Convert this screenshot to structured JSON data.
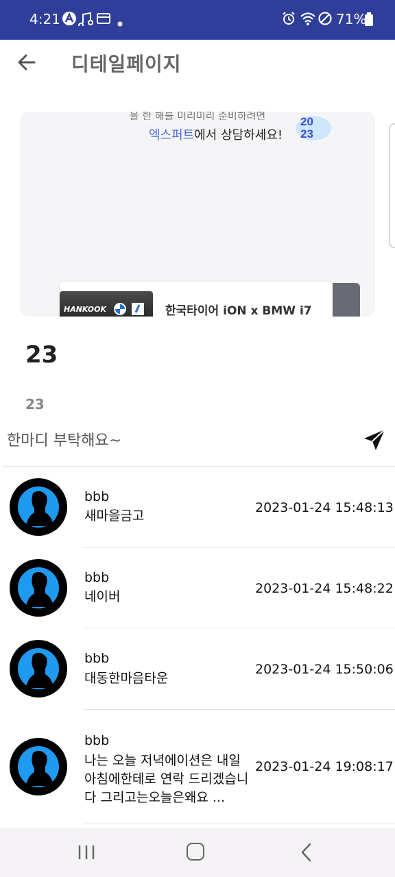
{
  "status_bar": {
    "time": "4:21",
    "battery": "71%"
  },
  "app_bar": {
    "title": "디테일페이지"
  },
  "banner": {
    "top_text": "올 한 해를 미리미리 준비하려면",
    "tagline_highlight": "엑스퍼트",
    "tagline_rest": "에서 상담하세요!",
    "badge": "2023",
    "badge_top": "20",
    "badge_bottom": "23",
    "ad_brand": "HANKOOK",
    "ad_title": "한국타이어 iON x BMW i7"
  },
  "post": {
    "title": "23",
    "body": "23"
  },
  "comment_input": {
    "placeholder": "한마디 부탁해요~"
  },
  "comments": [
    {
      "user": "bbb",
      "text": "새마을금고",
      "time": "2023-01-24 15:48:13"
    },
    {
      "user": "bbb",
      "text": "네이버",
      "time": "2023-01-24 15:48:22"
    },
    {
      "user": "bbb",
      "text": "대동한마음타운",
      "time": "2023-01-24 15:50:06"
    },
    {
      "user": "bbb",
      "text": "나는 오늘 저녁에이션은 내일 아침에한테로 연락 드리겠습니다 그리고는오늘은왜요 ...",
      "time": "2023-01-24 19:08:17"
    }
  ],
  "colors": {
    "status_bar": "#2e3e9a",
    "avatar_accent": "#1e9bf0",
    "banner_bg": "#f5f5f7",
    "highlight": "#4a68d8"
  },
  "icons": {
    "back": "back-arrow-icon",
    "send": "send-icon",
    "avatar": "person-silhouette-icon"
  }
}
